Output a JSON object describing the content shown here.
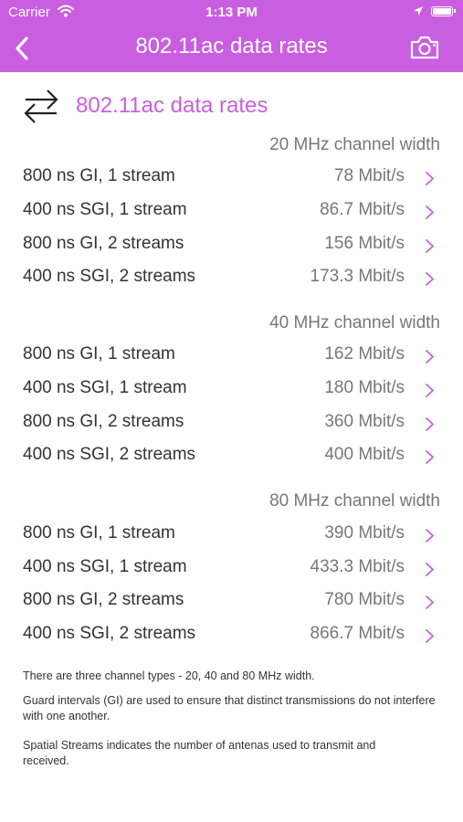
{
  "status_bar": {
    "carrier": "Carrier",
    "time": "1:13 PM"
  },
  "nav": {
    "title": "802.11ac data rates"
  },
  "header": {
    "title": "802.11ac data rates"
  },
  "sections": [
    {
      "title": "20 MHz channel width",
      "rows": [
        {
          "label": "800 ns GI, 1 stream",
          "value": "78 Mbit/s"
        },
        {
          "label": "400 ns SGI, 1 stream",
          "value": "86.7 Mbit/s"
        },
        {
          "label": "800 ns GI, 2 streams",
          "value": "156 Mbit/s"
        },
        {
          "label": "400 ns SGI, 2 streams",
          "value": "173.3 Mbit/s"
        }
      ]
    },
    {
      "title": "40 MHz channel width",
      "rows": [
        {
          "label": "800 ns GI, 1 stream",
          "value": "162 Mbit/s"
        },
        {
          "label": "400 ns SGI, 1 stream",
          "value": "180 Mbit/s"
        },
        {
          "label": "800 ns GI, 2 streams",
          "value": "360 Mbit/s"
        },
        {
          "label": "400 ns SGI, 2 streams",
          "value": "400 Mbit/s"
        }
      ]
    },
    {
      "title": "80 MHz channel width",
      "rows": [
        {
          "label": "800 ns GI, 1 stream",
          "value": "390 Mbit/s"
        },
        {
          "label": "400 ns SGI, 1 stream",
          "value": "433.3 Mbit/s"
        },
        {
          "label": "800 ns GI, 2 streams",
          "value": "780 Mbit/s"
        },
        {
          "label": "400 ns SGI, 2 streams",
          "value": "866.7 Mbit/s"
        }
      ]
    }
  ],
  "footnotes": [
    "There are three channel types - 20, 40 and 80 MHz width.",
    "Guard intervals (GI) are used to ensure that distinct transmissions do not interfere with one another.",
    "Spatial Streams indicates the number of antenas used to transmit and received."
  ],
  "colors": {
    "accent": "#c95ee0",
    "text": "#333333",
    "secondary_text": "#777777"
  },
  "icons": {
    "back": "chevron-left-icon",
    "camera": "camera-icon",
    "header": "swap-arrows-icon",
    "row": "chevron-right-icon",
    "wifi": "wifi-icon",
    "location": "location-arrow-icon",
    "battery": "battery-icon"
  }
}
